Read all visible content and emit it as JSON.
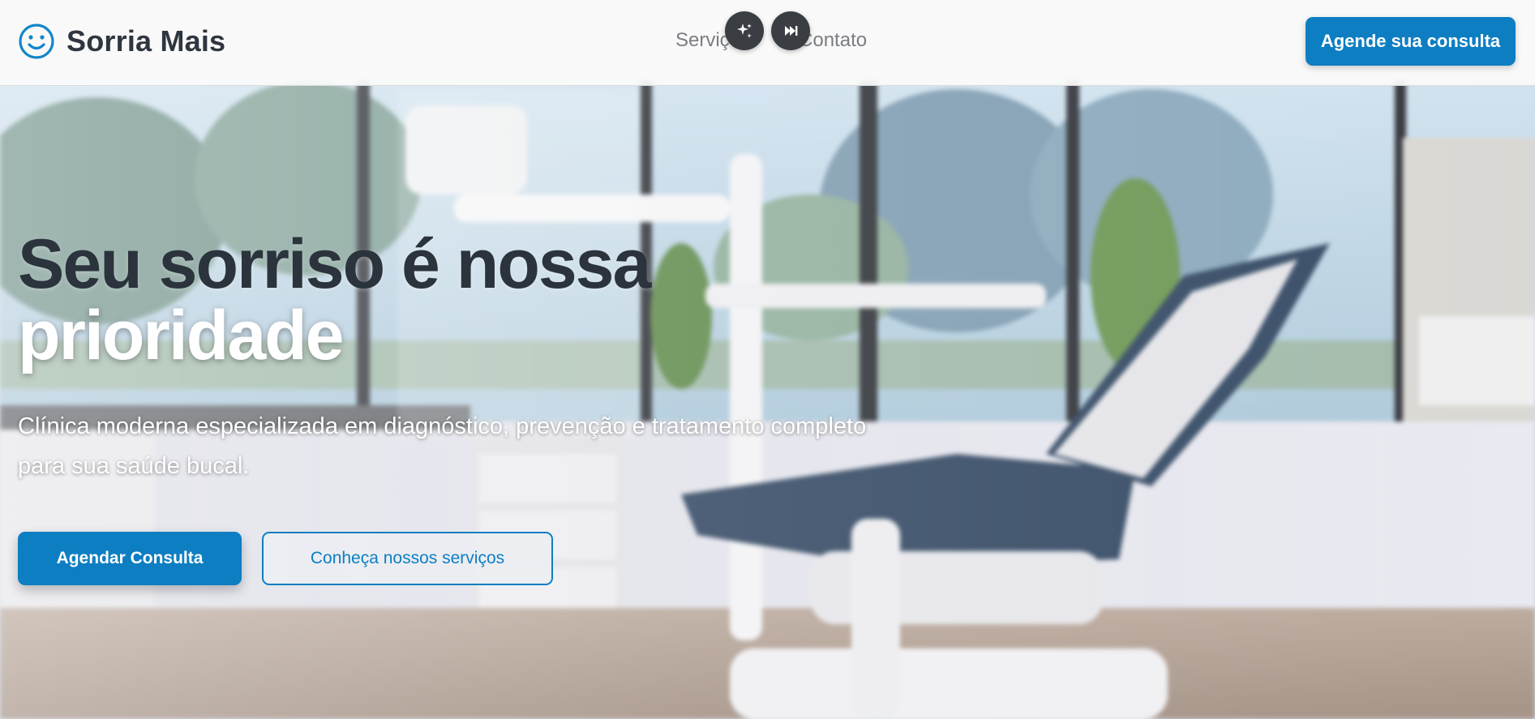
{
  "header": {
    "brand_name": "Sorria Mais",
    "nav": [
      {
        "label": "Serviços"
      },
      {
        "label": "Contato"
      }
    ],
    "cta_label": "Agende sua consulta"
  },
  "floating_controls": {
    "sparkle_icon": "sparkle-icon",
    "skip_icon": "skip-forward-icon"
  },
  "hero": {
    "title_line1": "Seu sorriso é nossa",
    "title_line2": "prioridade",
    "subtitle": "Clínica moderna especializada em diagnóstico, prevenção e tratamento completo para sua saúde bucal.",
    "primary_button": "Agendar Consulta",
    "secondary_button": "Conheça nossos serviços"
  },
  "colors": {
    "accent": "#0e7ec2",
    "title_dark": "#2b333c",
    "header_bg": "#fafafa"
  }
}
